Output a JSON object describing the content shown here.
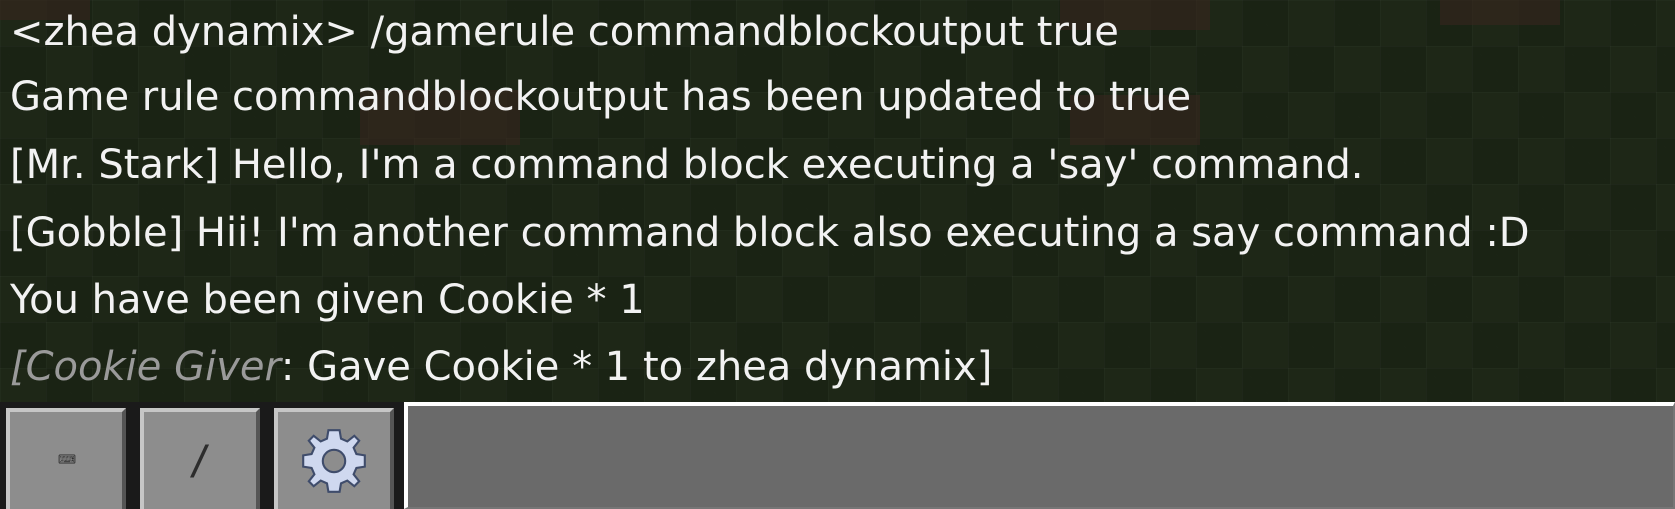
{
  "chat": {
    "lines": [
      {
        "text": "<zhea dynamix>  /gamerule commandblockoutput true"
      },
      {
        "text": "Game rule commandblockoutput has been updated to true"
      },
      {
        "text": "[Mr. Stark] Hello, I'm a command block executing a 'say' command."
      },
      {
        "text": "[Gobble] Hii! I'm another command block also executing a say command :D"
      },
      {
        "text": "You have been given Cookie * 1"
      },
      {
        "prefix": "[Cookie Giver",
        "suffix": ": Gave Cookie * 1 to zhea dynamix]"
      }
    ]
  },
  "toolbar": {
    "keyboard_icon": "keyboard-icon",
    "slash_label": "/",
    "settings_icon": "gear-icon",
    "input_value": "",
    "input_placeholder": ""
  },
  "colors": {
    "chat_text": "#f2f2f2",
    "muted_text": "#9a9a9a",
    "button_face": "#8d8d8d",
    "input_bg": "#6a6a6a"
  }
}
